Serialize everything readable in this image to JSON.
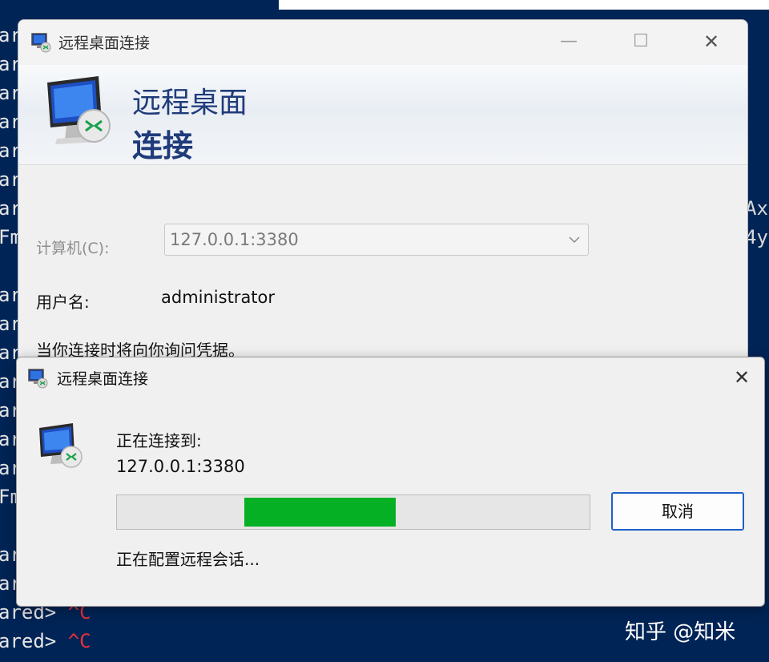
{
  "terminal": {
    "left_lines": [
      {
        "text": "ar",
        "ctrl": ""
      },
      {
        "text": "ar",
        "ctrl": ""
      },
      {
        "text": "ar",
        "ctrl": ""
      },
      {
        "text": "ar",
        "ctrl": ""
      },
      {
        "text": "ar",
        "ctrl": ""
      },
      {
        "text": "ar",
        "ctrl": ""
      },
      {
        "text": "ar",
        "ctrl": ""
      },
      {
        "text": "Fm",
        "ctrl": ""
      },
      {
        "text": "ar",
        "ctrl": ""
      },
      {
        "text": "ar",
        "ctrl": ""
      },
      {
        "text": "ar",
        "ctrl": ""
      },
      {
        "text": "ar",
        "ctrl": ""
      },
      {
        "text": "ar",
        "ctrl": ""
      },
      {
        "text": "ar",
        "ctrl": ""
      },
      {
        "text": "ar",
        "ctrl": ""
      },
      {
        "text": "Fm",
        "ctrl": ""
      },
      {
        "text": "ar",
        "ctrl": ""
      },
      {
        "text": "ar",
        "ctrl": ""
      },
      {
        "text": "ared> ",
        "ctrl": "^C"
      },
      {
        "text": "ared> ",
        "ctrl": "^C"
      }
    ],
    "right_lines": [
      "Ax",
      "4y"
    ],
    "ctrl_color": "#e8323a",
    "background_color": "#012456"
  },
  "main_window": {
    "title": "远程桌面连接",
    "banner_line1": "远程桌面",
    "banner_line2": "连接",
    "computer_label": "计算机(C):",
    "computer_value": "127.0.0.1:3380",
    "username_label": "用户名:",
    "username_value": "administrator",
    "credentials_note": "当你连接时将向你询问凭据。",
    "controls": {
      "minimize": "—",
      "maximize": "☐",
      "close": "✕"
    }
  },
  "dialog": {
    "title": "远程桌面连接",
    "close_glyph": "✕",
    "connecting_label": "正在连接到:",
    "host": "127.0.0.1:3380",
    "progress": {
      "start": 0.27,
      "end": 0.59,
      "color": "#06b025"
    },
    "cancel_label": "取消",
    "status": "正在配置远程会话..."
  },
  "watermark": "知乎 @知米",
  "colors": {
    "brand_blue": "#1f3b7a",
    "button_focus": "#1e60c8"
  }
}
